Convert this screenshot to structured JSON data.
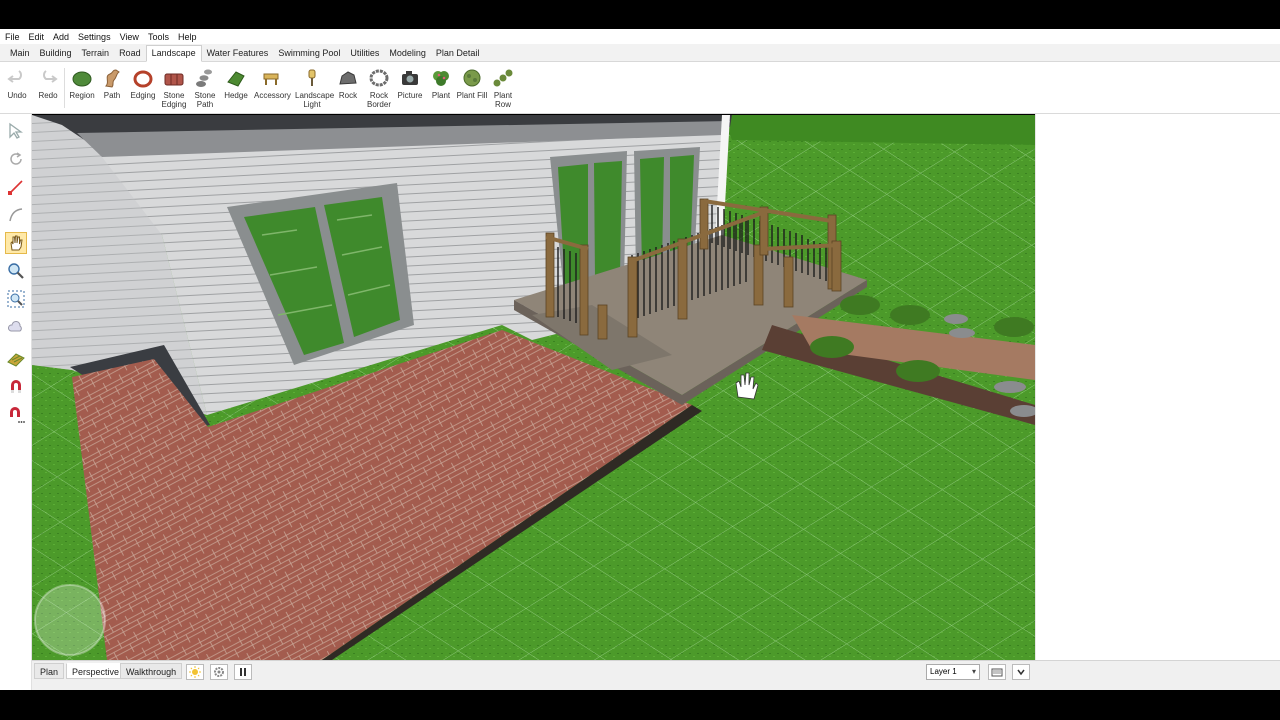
{
  "menu": [
    "File",
    "Edit",
    "Add",
    "Settings",
    "View",
    "Tools",
    "Help"
  ],
  "tabs": [
    {
      "label": "Main",
      "active": false
    },
    {
      "label": "Building",
      "active": false
    },
    {
      "label": "Terrain",
      "active": false
    },
    {
      "label": "Road",
      "active": false
    },
    {
      "label": "Landscape",
      "active": true
    },
    {
      "label": "Water Features",
      "active": false
    },
    {
      "label": "Swimming Pool",
      "active": false
    },
    {
      "label": "Utilities",
      "active": false
    },
    {
      "label": "Modeling",
      "active": false
    },
    {
      "label": "Plan Detail",
      "active": false
    }
  ],
  "ribbon": {
    "undo": "Undo",
    "redo": "Redo",
    "region": "Region",
    "path": "Path",
    "edging": "Edging",
    "stone_edging": "Stone Edging",
    "stone_path": "Stone Path",
    "hedge": "Hedge",
    "accessory": "Accessory",
    "landscape_light": "Landscape Light",
    "rock": "Rock",
    "rock_border": "Rock Border",
    "picture": "Picture",
    "plant": "Plant",
    "plant_fill": "Plant Fill",
    "plant_row": "Plant Row"
  },
  "left_tools": [
    "select-arrow-icon",
    "orbit-icon",
    "pan-line-icon",
    "arc-icon",
    "hand-pan-icon",
    "zoom-icon",
    "zoom-extents-icon",
    "cloud-icon",
    "texture-icon",
    "magnet-icon",
    "magnet-more-icon"
  ],
  "active_left_tool": "hand-pan-icon",
  "view_tabs": {
    "plan": "Plan",
    "perspective": "Perspective",
    "walkthrough": "Walkthrough",
    "active": "Perspective"
  },
  "layer": {
    "value": "Layer 1"
  },
  "colors": {
    "accent": "#e5b94a",
    "grass": "#4f9a2c",
    "brick": "#a56052",
    "siding": "#d9dadb"
  }
}
